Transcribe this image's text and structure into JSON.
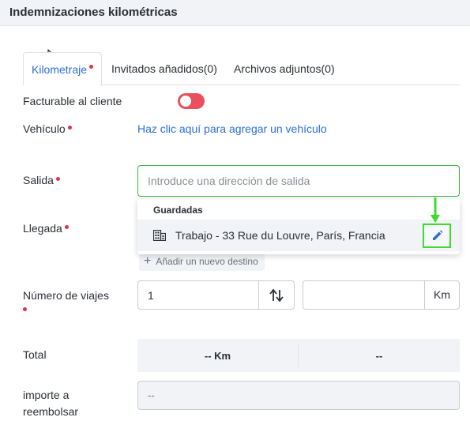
{
  "header": {
    "title": "Indemnizaciones kilométricas"
  },
  "tabs": [
    {
      "label": "Kilometraje",
      "required": true
    },
    {
      "label": "Invitados añadidos(0)"
    },
    {
      "label": "Archivos adjuntos(0)"
    }
  ],
  "form": {
    "facturable_label": "Facturable al cliente",
    "facturable_on": false,
    "vehiculo_label": "Vehículo",
    "vehiculo_link": "Haz clic aquí para agregar un vehículo",
    "salida_label": "Salida",
    "salida_placeholder": "Introduce una dirección de salida",
    "llegada_label": "Llegada",
    "saved_header": "Guardadas",
    "saved_item": "Trabajo - 33 Rue du Louvre, París, Francia",
    "add_destination": "Añadir un nuevo destino",
    "viajes_label": "Número de viajes",
    "viajes_value": "1",
    "km_unit": "Km",
    "total_label": "Total",
    "total_km": "-- Km",
    "total_amount": "--",
    "importe_label_line1": "importe a",
    "importe_label_line2": "reembolsar",
    "importe_value": "--"
  },
  "colors": {
    "accent": "#2a6fd6",
    "required": "#e0344a",
    "toggle_off": "#e8505b",
    "input_focus": "#3bb04a",
    "highlight": "#3ddc2c"
  }
}
